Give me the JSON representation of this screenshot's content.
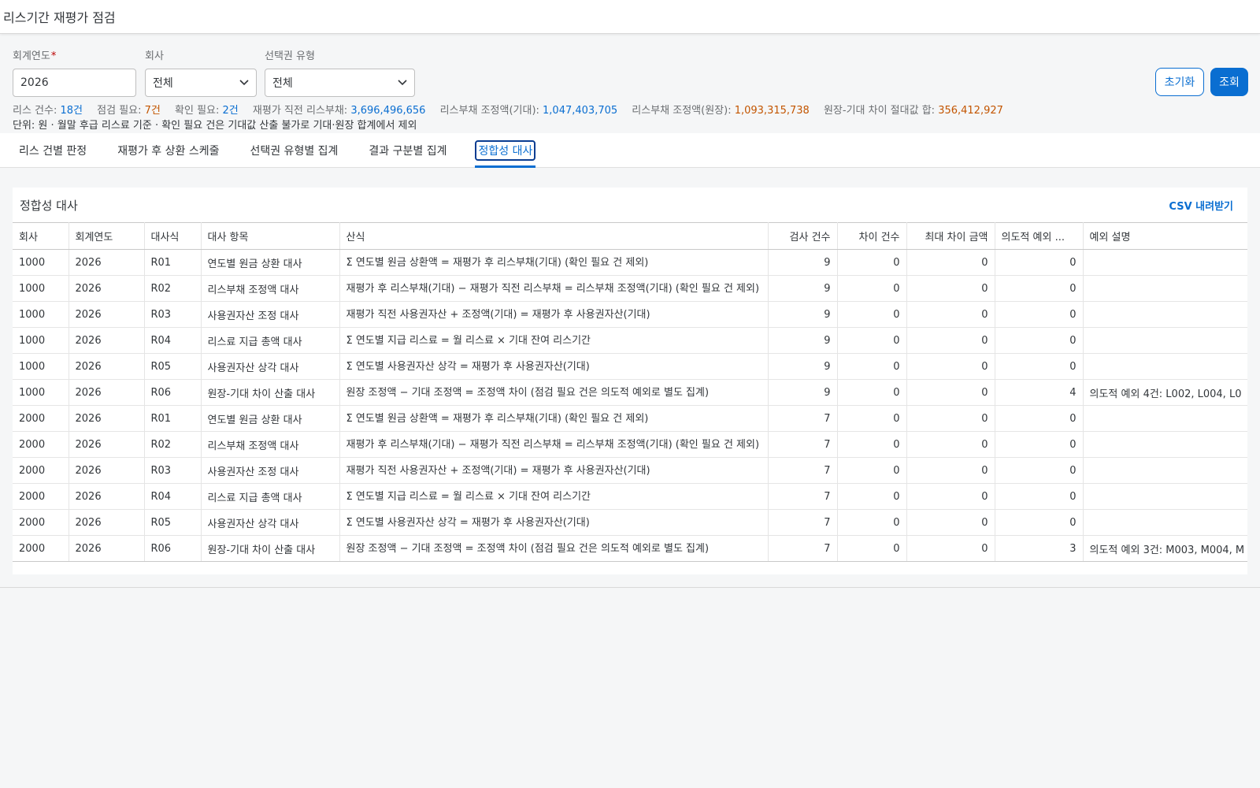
{
  "app": {
    "title": "리스기간 재평가 점검"
  },
  "filters": {
    "fiscal_year": {
      "label": "회계연도",
      "required_mark": "*",
      "value": "2026"
    },
    "company": {
      "label": "회사",
      "value": "전체"
    },
    "option_type": {
      "label": "선택권 유형",
      "value": "전체"
    }
  },
  "buttons": {
    "reset": "초기화",
    "search": "조회"
  },
  "summary": {
    "lease_count_label": "리스 건수:",
    "lease_count": "18건",
    "check_needed_label": "점검 필요:",
    "check_needed": "7건",
    "confirm_needed_label": "확인 필요:",
    "confirm_needed": "2건",
    "liability_before_label": "재평가 직전 리스부채:",
    "liability_before": "3,696,496,656",
    "adj_expected_label": "리스부채 조정액(기대):",
    "adj_expected": "1,047,403,705",
    "adj_ledger_label": "리스부채 조정액(원장):",
    "adj_ledger": "1,093,315,738",
    "diff_abs_label": "원장-기대 차이 절대값 합:",
    "diff_abs": "356,412,927",
    "unit_note": "단위: 원 · 월말 후급 리스료 기준 · 확인 필요 건은 기대값 산출 불가로 기대·원장 합계에서 제외"
  },
  "tabs": [
    {
      "label": "리스 건별 판정"
    },
    {
      "label": "재평가 후 상환 스케줄"
    },
    {
      "label": "선택권 유형별 집계"
    },
    {
      "label": "결과 구분별 집계"
    },
    {
      "label": "정합성 대사"
    }
  ],
  "active_tab": 4,
  "panel": {
    "title": "정합성 대사",
    "csv_link": "CSV 내려받기"
  },
  "table": {
    "columns": [
      "회사",
      "회계연도",
      "대사식",
      "대사 항목",
      "산식",
      "검사 건수",
      "차이 건수",
      "최대 차이 금액",
      "의도적 예외 ...",
      "예외 설명"
    ],
    "rows": [
      [
        "1000",
        "2026",
        "R01",
        "연도별 원금 상환 대사",
        "Σ 연도별 원금 상환액 = 재평가 후 리스부채(기대) (확인 필요 건 제외)",
        "9",
        "0",
        "0",
        "0",
        ""
      ],
      [
        "1000",
        "2026",
        "R02",
        "리스부채 조정액 대사",
        "재평가 후 리스부채(기대) − 재평가 직전 리스부채 = 리스부채 조정액(기대) (확인 필요 건 제외)",
        "9",
        "0",
        "0",
        "0",
        ""
      ],
      [
        "1000",
        "2026",
        "R03",
        "사용권자산 조정 대사",
        "재평가 직전 사용권자산 + 조정액(기대) = 재평가 후 사용권자산(기대)",
        "9",
        "0",
        "0",
        "0",
        ""
      ],
      [
        "1000",
        "2026",
        "R04",
        "리스료 지급 총액 대사",
        "Σ 연도별 지급 리스료 = 월 리스료 × 기대 잔여 리스기간",
        "9",
        "0",
        "0",
        "0",
        ""
      ],
      [
        "1000",
        "2026",
        "R05",
        "사용권자산 상각 대사",
        "Σ 연도별 사용권자산 상각 = 재평가 후 사용권자산(기대)",
        "9",
        "0",
        "0",
        "0",
        ""
      ],
      [
        "1000",
        "2026",
        "R06",
        "원장-기대 차이 산출 대사",
        "원장 조정액 − 기대 조정액 = 조정액 차이 (점검 필요 건은 의도적 예외로 별도 집계)",
        "9",
        "0",
        "0",
        "4",
        "의도적 예외 4건: L002, L004, L0"
      ],
      [
        "2000",
        "2026",
        "R01",
        "연도별 원금 상환 대사",
        "Σ 연도별 원금 상환액 = 재평가 후 리스부채(기대) (확인 필요 건 제외)",
        "7",
        "0",
        "0",
        "0",
        ""
      ],
      [
        "2000",
        "2026",
        "R02",
        "리스부채 조정액 대사",
        "재평가 후 리스부채(기대) − 재평가 직전 리스부채 = 리스부채 조정액(기대) (확인 필요 건 제외)",
        "7",
        "0",
        "0",
        "0",
        ""
      ],
      [
        "2000",
        "2026",
        "R03",
        "사용권자산 조정 대사",
        "재평가 직전 사용권자산 + 조정액(기대) = 재평가 후 사용권자산(기대)",
        "7",
        "0",
        "0",
        "0",
        ""
      ],
      [
        "2000",
        "2026",
        "R04",
        "리스료 지급 총액 대사",
        "Σ 연도별 지급 리스료 = 월 리스료 × 기대 잔여 리스기간",
        "7",
        "0",
        "0",
        "0",
        ""
      ],
      [
        "2000",
        "2026",
        "R05",
        "사용권자산 상각 대사",
        "Σ 연도별 사용권자산 상각 = 재평가 후 사용권자산(기대)",
        "7",
        "0",
        "0",
        "0",
        ""
      ],
      [
        "2000",
        "2026",
        "R06",
        "원장-기대 차이 산출 대사",
        "원장 조정액 − 기대 조정액 = 조정액 차이 (점검 필요 건은 의도적 예외로 별도 집계)",
        "7",
        "0",
        "0",
        "3",
        "의도적 예외 3건: M003, M004, M"
      ]
    ]
  }
}
